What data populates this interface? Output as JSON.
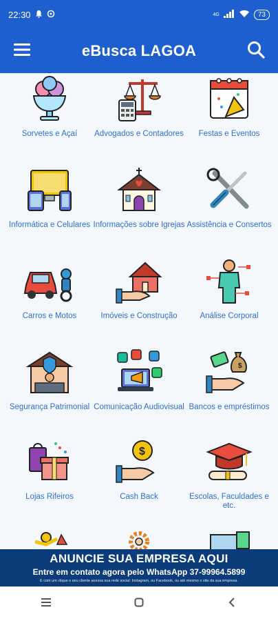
{
  "status": {
    "time": "22:30",
    "battery": "73",
    "network": "4G"
  },
  "header": {
    "title": "eBusca LAGOA",
    "menu_icon": "menu-icon",
    "search_icon": "search-icon"
  },
  "categories": [
    {
      "label": "Sorvetes e Açaí",
      "icon": "ice-cream-icon"
    },
    {
      "label": "Advogados e Contadores",
      "icon": "scale-calculator-icon"
    },
    {
      "label": "Festas e Eventos",
      "icon": "calendar-party-icon"
    },
    {
      "label": "Informática e Celulares",
      "icon": "computer-phone-icon"
    },
    {
      "label": "Informações sobre Igrejas",
      "icon": "church-icon"
    },
    {
      "label": "Assistência e Consertos",
      "icon": "tools-icon"
    },
    {
      "label": "Carros e Motos",
      "icon": "car-motorcycle-icon"
    },
    {
      "label": "Imóveis e Construção",
      "icon": "house-hand-icon"
    },
    {
      "label": "Análise Corporal",
      "icon": "body-analysis-icon"
    },
    {
      "label": "Segurança Patrimonial",
      "icon": "security-guard-icon"
    },
    {
      "label": "Comunicação Audiovisual",
      "icon": "media-laptop-icon"
    },
    {
      "label": "Bancos e empréstimos",
      "icon": "money-hand-icon"
    },
    {
      "label": "Lojas Rifeiros",
      "icon": "gift-bag-icon"
    },
    {
      "label": "Cash Back",
      "icon": "coin-hand-icon"
    },
    {
      "label": "Escolas, Faculdades e etc.",
      "icon": "graduation-cap-icon"
    }
  ],
  "banner": {
    "title": "ANUNCIE SUA EMPRESA AQUI",
    "subtitle": "Entre em contato agora pelo WhatsApp 37-99964.5899",
    "fineprint": "E com um clique o seu cliente acessa sua rede social: Instagram, ou Facebook, ou até mesmo o site da sua empresa."
  },
  "colors": {
    "primary": "#1e5fcf",
    "banner": "#0d3c7a",
    "label": "#2f6fcf"
  }
}
